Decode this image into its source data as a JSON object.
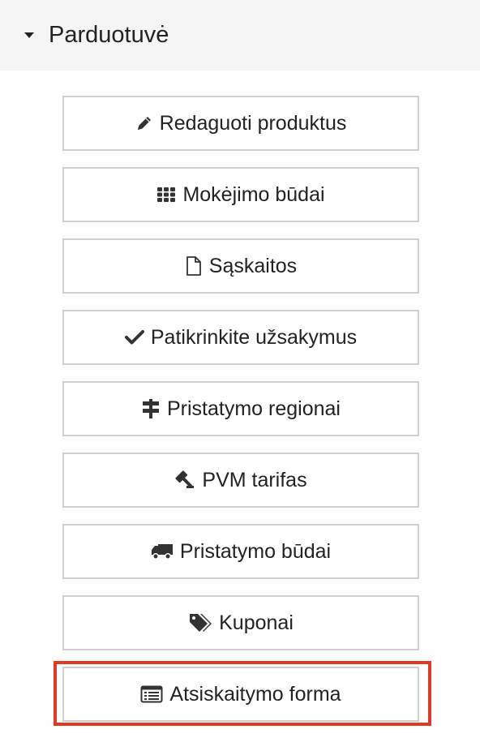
{
  "section": {
    "title": "Parduotuvė",
    "expanded": true
  },
  "menu": {
    "items": [
      {
        "label": "Redaguoti produktus",
        "icon": "pencil-icon"
      },
      {
        "label": "Mokėjimo būdai",
        "icon": "grid-icon"
      },
      {
        "label": "Sąskaitos",
        "icon": "document-icon"
      },
      {
        "label": "Patikrinkite užsakymus",
        "icon": "checkmark-icon"
      },
      {
        "label": "Pristatymo regionai",
        "icon": "signpost-icon"
      },
      {
        "label": "PVM tarifas",
        "icon": "gavel-icon"
      },
      {
        "label": "Pristatymo būdai",
        "icon": "truck-icon"
      },
      {
        "label": "Kuponai",
        "icon": "tags-icon"
      },
      {
        "label": "Atsiskaitymo forma",
        "icon": "list-alt-icon"
      }
    ],
    "highlighted_index": 8
  },
  "colors": {
    "highlight": "#e03a27",
    "border": "#cfcfcf",
    "header_bg": "#f5f5f5",
    "text": "#222222"
  }
}
